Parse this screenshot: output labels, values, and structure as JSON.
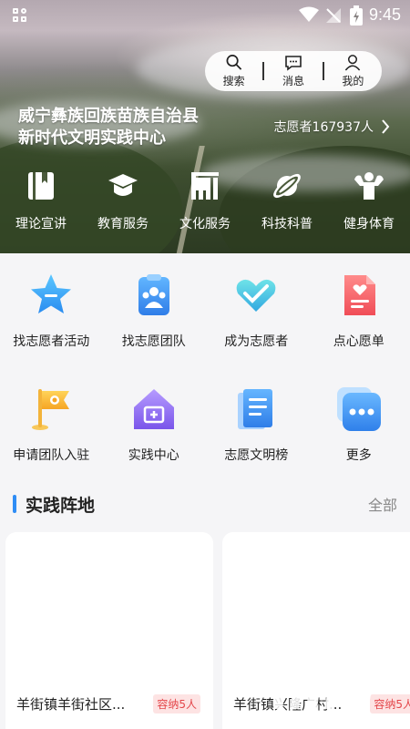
{
  "status_bar": {
    "time": "9:45"
  },
  "top_actions": [
    {
      "label": "搜索",
      "icon": "search-icon"
    },
    {
      "label": "消息",
      "icon": "message-icon"
    },
    {
      "label": "我的",
      "icon": "user-icon"
    }
  ],
  "header": {
    "title_line1": "威宁彝族回族苗族自治县",
    "title_line2": "新时代文明实践中心",
    "volunteer_count": "志愿者167937人"
  },
  "categories": [
    {
      "label": "理论宣讲",
      "icon": "book-icon"
    },
    {
      "label": "教育服务",
      "icon": "graduation-cap-icon"
    },
    {
      "label": "文化服务",
      "icon": "piano-icon"
    },
    {
      "label": "科技科普",
      "icon": "planet-icon"
    },
    {
      "label": "健身体育",
      "icon": "muscle-icon"
    }
  ],
  "services": [
    {
      "label": "找志愿者活动",
      "icon": "star-icon"
    },
    {
      "label": "找志愿团队",
      "icon": "team-clipboard-icon"
    },
    {
      "label": "成为志愿者",
      "icon": "heart-hands-icon"
    },
    {
      "label": "点心愿单",
      "icon": "wish-list-icon"
    },
    {
      "label": "申请团队入驻",
      "icon": "flag-icon"
    },
    {
      "label": "实践中心",
      "icon": "house-icon"
    },
    {
      "label": "志愿文明榜",
      "icon": "document-icon"
    },
    {
      "label": "更多",
      "icon": "more-icon"
    }
  ],
  "section": {
    "title": "实践阵地",
    "more": "全部"
  },
  "cards": [
    {
      "name": "羊街镇羊街社区...",
      "tag": "容纳5人"
    },
    {
      "name": "羊街镇兴隆广村...",
      "tag": "容纳5人"
    }
  ],
  "colors": {
    "accent": "#2f8df5",
    "tag_red": "#e4464a"
  }
}
